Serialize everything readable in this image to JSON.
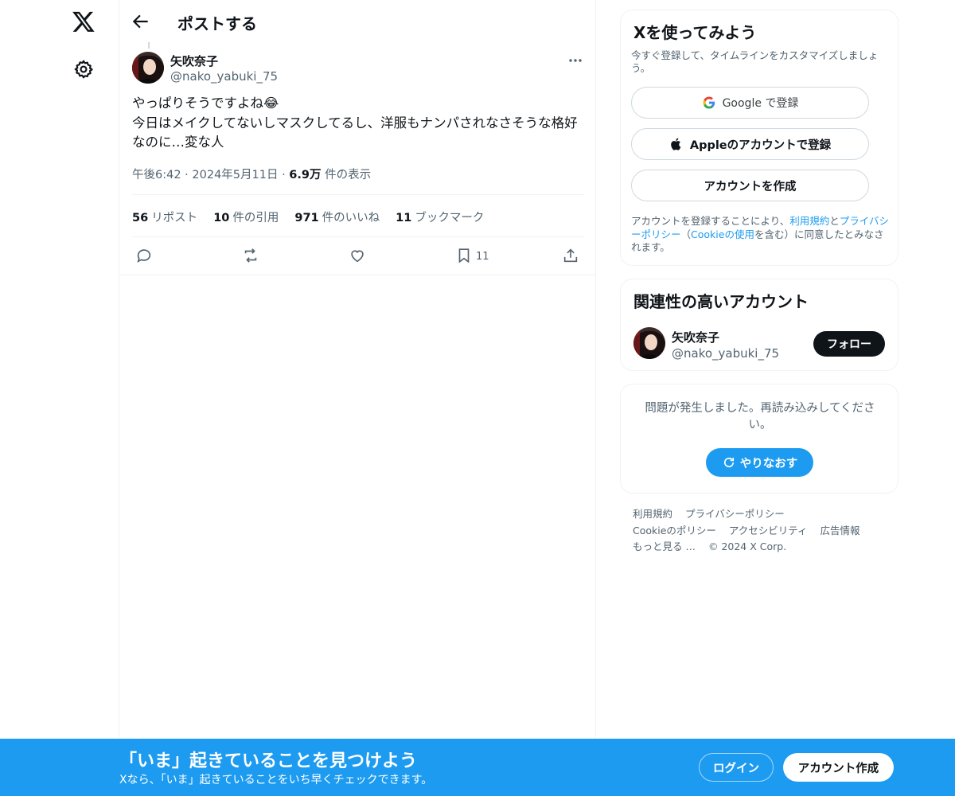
{
  "theme": {
    "accent": "#1d9bf0",
    "text": "#0f1419",
    "muted": "#536471",
    "border": "#eff3f4"
  },
  "nav": {
    "logo_icon": "x-logo-icon",
    "settings_icon": "gear-icon"
  },
  "header": {
    "back_icon": "arrow-left-icon",
    "title": "ポストする"
  },
  "post": {
    "author_name": "矢吹奈子",
    "author_handle": "@nako_yabuki_75",
    "text_line1": "やっぱりそうですよね😂",
    "text_line2": "今日はメイクしてないしマスクしてるし、洋服もナンパされなさそうな格好なのに…変な人",
    "time": "午後6:42",
    "dot1": "·",
    "date": "2024年5月11日",
    "dot2": "·",
    "views_count": "6.9万",
    "views_label": "件の表示",
    "stats": [
      {
        "count": "56",
        "label": "リポスト"
      },
      {
        "count": "10",
        "label": "件の引用"
      },
      {
        "count": "971",
        "label": "件のいいね"
      },
      {
        "count": "11",
        "label": "ブックマーク"
      }
    ],
    "actions": [
      "reply-icon",
      "repost-icon",
      "like-icon",
      "bookmark-icon",
      "share-icon"
    ],
    "bookmark_count": "11"
  },
  "signup_card": {
    "title": "Xを使ってみよう",
    "subtitle": "今すぐ登録して、タイムラインをカスタマイズしましょう。",
    "google_label": "Google で登録",
    "apple_label": "Appleのアカウントで登録",
    "create_label": "アカウントを作成",
    "legal_1": "アカウントを登録することにより、",
    "legal_terms": "利用規約",
    "legal_2": "と",
    "legal_privacy": "プライバシーポリシー",
    "legal_3": "（",
    "legal_cookie": "Cookieの使用",
    "legal_4": "を含む）に同意したとみなされます。"
  },
  "related": {
    "title": "関連性の高いアカウント",
    "name": "矢吹奈子",
    "handle": "@nako_yabuki_75",
    "follow_label": "フォロー"
  },
  "error_card": {
    "message": "問題が発生しました。再読み込みしてください。",
    "retry_label": "やりなおす"
  },
  "footer": {
    "terms": "利用規約",
    "privacy": "プライバシーポリシー",
    "cookie": "Cookieのポリシー",
    "accessibility": "アクセシビリティ",
    "ads": "広告情報",
    "more": "もっと見る …",
    "copyright": "© 2024 X Corp."
  },
  "banner": {
    "title": "「いま」起きていることを見つけよう",
    "subtitle": "Xなら、「いま」起きていることをいち早くチェックできます。",
    "login_label": "ログイン",
    "signup_label": "アカウント作成"
  }
}
